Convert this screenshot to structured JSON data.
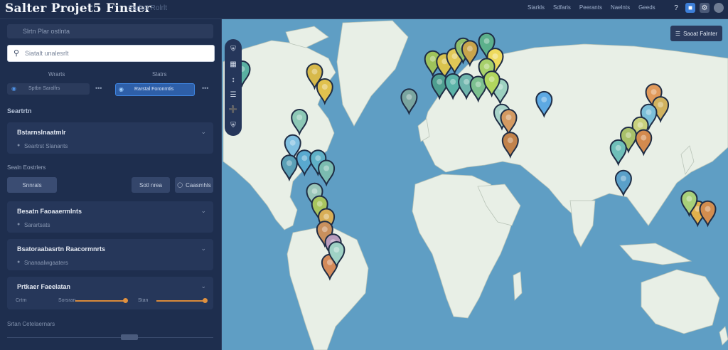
{
  "app": {
    "title": "Salter Projet5 Finder",
    "subtitle": "Sarhst Rolrlt"
  },
  "top_nav": [
    "Siarkls",
    "Sdfaris",
    "Peerants",
    "Naelnts",
    "Geeds"
  ],
  "sidebar": {
    "region_field": "Slrtn Plar ostlnta",
    "search": {
      "placeholder": "Siatalt unalesrlt"
    },
    "col_labels": [
      "Wrarts",
      "Slatrs"
    ],
    "selector_left": "Sptbn Saralfrs",
    "selector_right": "Rarstal Foronmtis",
    "section1": "Seartrtn",
    "card1": {
      "title": "Bstarnslnaatmlr",
      "sub": "Seartrst Slanants"
    },
    "section2": "Sealn Eostrlers",
    "buttons": {
      "primary": "Snnrals",
      "b2": "Sotl nrea",
      "b3": "Caasmhls"
    },
    "card2": {
      "title": "Besatn Faoaaermlnts",
      "sub": "Sarartsats"
    },
    "card3": {
      "title": "Bsatoraabasrtn Raacormnrts",
      "sub": "Snanaalwgaaters"
    },
    "card4": {
      "title": "Prtkaer Faeelatan",
      "slider_left": "Crtrn",
      "slider_mid": "Sorsran",
      "slider_right": "Stan"
    },
    "footer": "Srtan Cetelaernars"
  },
  "map": {
    "filter_label": "Saoat Falnter",
    "toolbar_icons": [
      "shield-icon",
      "grid-icon",
      "expand-icon",
      "layers-icon",
      "zoom-icon",
      "shield-small-icon"
    ],
    "pins": [
      {
        "lon": -80,
        "lat": 48,
        "c": "#d7b94a"
      },
      {
        "lon": -74,
        "lat": 42,
        "c": "#e0c14e"
      },
      {
        "lon": -123,
        "lat": 49,
        "c": "#5ab0a1"
      },
      {
        "lon": -10,
        "lat": 53,
        "c": "#9fc35b"
      },
      {
        "lon": -3,
        "lat": 52,
        "c": "#d9c34e"
      },
      {
        "lon": 3,
        "lat": 54,
        "c": "#e1c857"
      },
      {
        "lon": 8,
        "lat": 58,
        "c": "#8fbf6b"
      },
      {
        "lon": 12,
        "lat": 57,
        "c": "#c9a54c"
      },
      {
        "lon": 22,
        "lat": 60,
        "c": "#5cb08b"
      },
      {
        "lon": 27,
        "lat": 54,
        "c": "#eeda5e"
      },
      {
        "lon": 22,
        "lat": 50,
        "c": "#a7d06b"
      },
      {
        "lon": -6,
        "lat": 44,
        "c": "#4e9e8f"
      },
      {
        "lon": 2,
        "lat": 44,
        "c": "#5bb3a8"
      },
      {
        "lon": 10,
        "lat": 44,
        "c": "#6fb5ad"
      },
      {
        "lon": 17,
        "lat": 43,
        "c": "#7cc08f"
      },
      {
        "lon": 30,
        "lat": 42,
        "c": "#9dd1c0"
      },
      {
        "lon": 25,
        "lat": 45,
        "c": "#b1d65e"
      },
      {
        "lon": -24,
        "lat": 38,
        "c": "#7aa5a0"
      },
      {
        "lon": 31,
        "lat": 32,
        "c": "#a8d3c9"
      },
      {
        "lon": 35,
        "lat": 30,
        "c": "#d49a62"
      },
      {
        "lon": 36,
        "lat": 21,
        "c": "#c1824b"
      },
      {
        "lon": 56,
        "lat": 37,
        "c": "#5da9e3"
      },
      {
        "lon": -89,
        "lat": 30,
        "c": "#8dc8b6"
      },
      {
        "lon": -93,
        "lat": 20,
        "c": "#7fbfe0"
      },
      {
        "lon": -86,
        "lat": 14,
        "c": "#59a9cf"
      },
      {
        "lon": -95,
        "lat": 12,
        "c": "#5a9fb6"
      },
      {
        "lon": -78,
        "lat": 14,
        "c": "#5fb0c6"
      },
      {
        "lon": -73,
        "lat": 10,
        "c": "#7bbcb0"
      },
      {
        "lon": -80,
        "lat": 1,
        "c": "#9ac6b9"
      },
      {
        "lon": -77,
        "lat": -4,
        "c": "#a8c55e"
      },
      {
        "lon": -73,
        "lat": -9,
        "c": "#d8ae57"
      },
      {
        "lon": -74,
        "lat": -14,
        "c": "#c9905e"
      },
      {
        "lon": -69,
        "lat": -19,
        "c": "#b79bbd"
      },
      {
        "lon": -71,
        "lat": -27,
        "c": "#d48a59"
      },
      {
        "lon": -67,
        "lat": -22,
        "c": "#9fd2c5"
      },
      {
        "lon": 121,
        "lat": 40,
        "c": "#e19a5b"
      },
      {
        "lon": 125,
        "lat": 35,
        "c": "#d1b25e"
      },
      {
        "lon": 118,
        "lat": 32,
        "c": "#7cbfd9"
      },
      {
        "lon": 113,
        "lat": 27,
        "c": "#c9d17d"
      },
      {
        "lon": 106,
        "lat": 23,
        "c": "#a8c06a"
      },
      {
        "lon": 115,
        "lat": 22,
        "c": "#d38a4e"
      },
      {
        "lon": 100,
        "lat": 18,
        "c": "#6fbfb9"
      },
      {
        "lon": 103,
        "lat": 6,
        "c": "#5aa0c9"
      },
      {
        "lon": 147,
        "lat": -6,
        "c": "#e0b04c"
      },
      {
        "lon": 153,
        "lat": -6,
        "c": "#d28d4f"
      },
      {
        "lon": 142,
        "lat": -2,
        "c": "#a8d07a"
      }
    ]
  }
}
